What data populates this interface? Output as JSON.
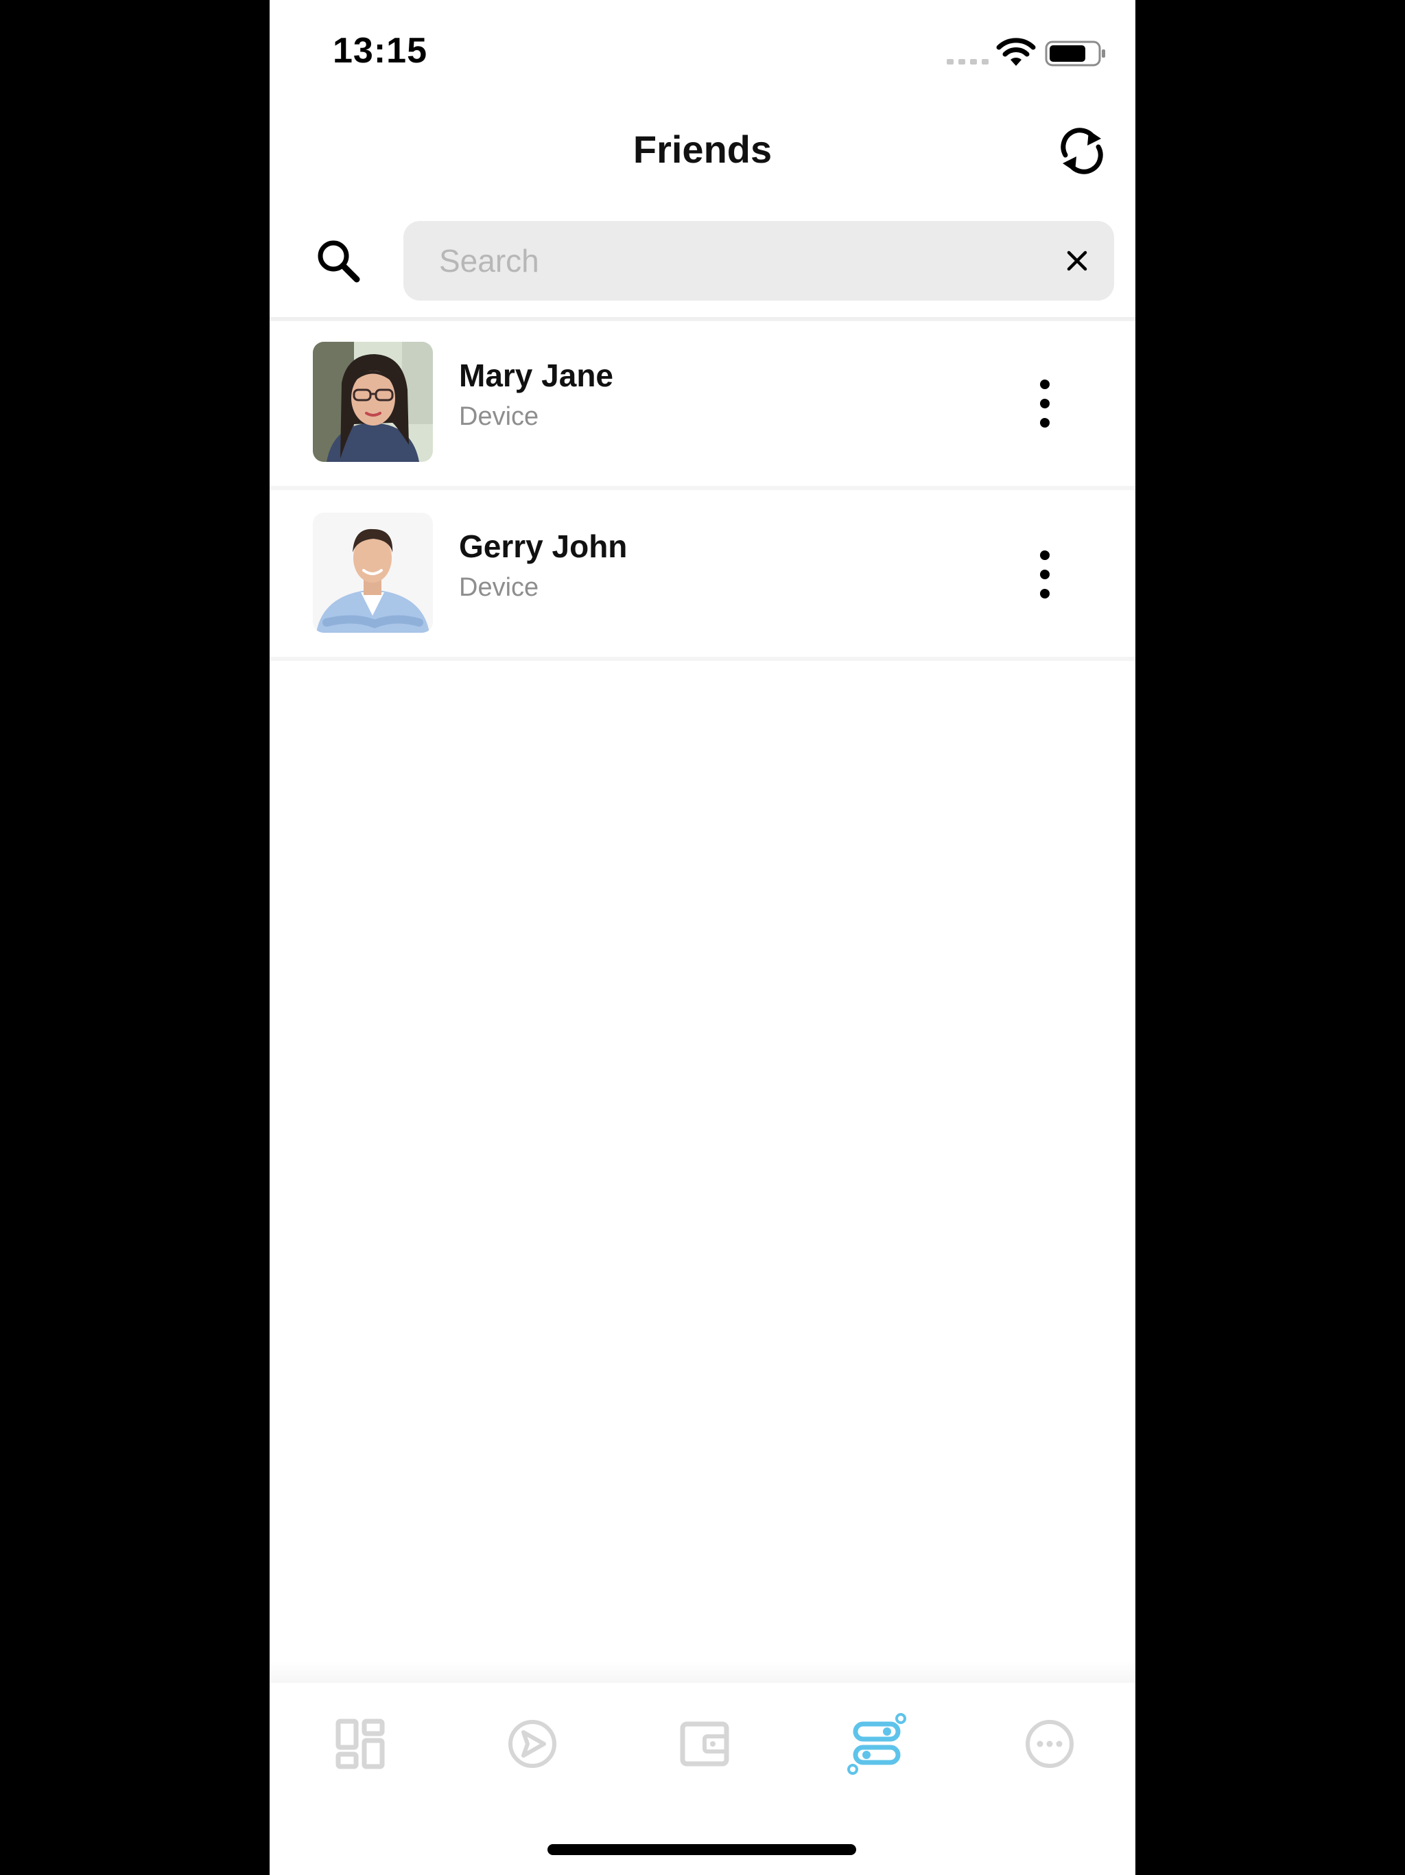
{
  "status_bar": {
    "time": "13:15"
  },
  "header": {
    "title": "Friends"
  },
  "search": {
    "placeholder": "Search",
    "value": ""
  },
  "friends": [
    {
      "name": "Mary Jane",
      "subtitle": "Device"
    },
    {
      "name": "Gerry John",
      "subtitle": "Device"
    }
  ],
  "tab_bar": {
    "tabs": [
      {
        "icon": "dashboard-icon",
        "active": false
      },
      {
        "icon": "send-icon",
        "active": false
      },
      {
        "icon": "wallet-icon",
        "active": false
      },
      {
        "icon": "connections-icon",
        "active": true
      },
      {
        "icon": "more-icon",
        "active": false
      }
    ]
  },
  "colors": {
    "accent": "#5ec3ea",
    "inactive_icon": "#d6d6d6",
    "search_bg": "#ebebeb",
    "subtitle": "#8e8e8e"
  }
}
